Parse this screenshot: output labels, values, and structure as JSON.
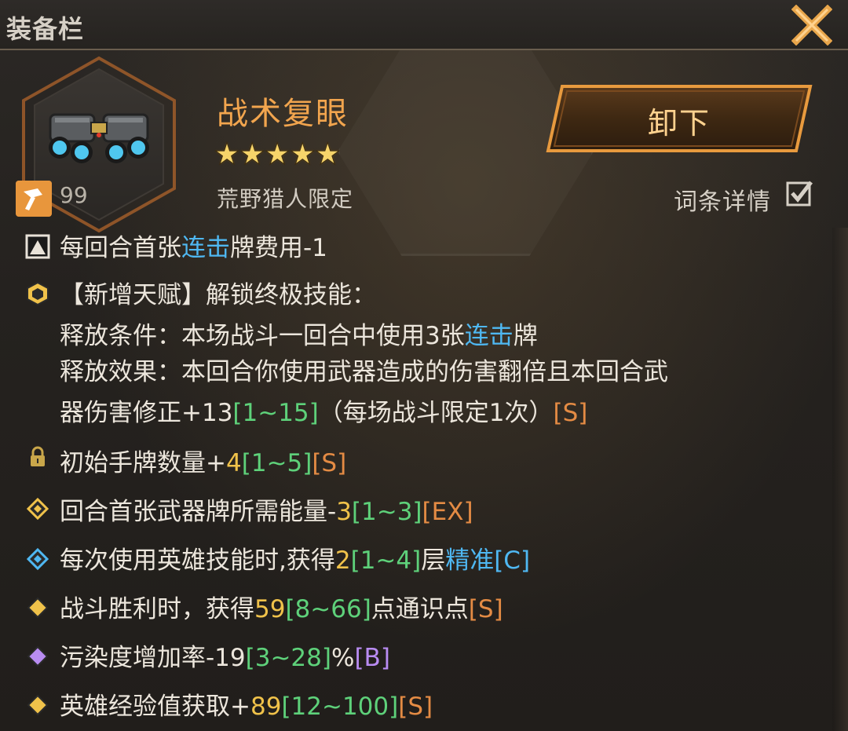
{
  "header": {
    "title": "装备栏",
    "close_icon": "close-x-icon"
  },
  "item": {
    "name": "战术复眼",
    "stars": "★★★★★",
    "star_count": 5,
    "source": "荒野猎人限定",
    "level": "99",
    "image_icon": "tactical-goggles-icon"
  },
  "actions": {
    "unequip_label": "卸下",
    "detail_label": "词条详情",
    "detail_checked": true
  },
  "colors": {
    "accent_orange": "#f2a54e",
    "keyword_blue": "#4fb8f2",
    "value_yellow": "#f0c24a",
    "range_green": "#5ed17a",
    "tier_s": "#e48b44",
    "tier_b": "#b98cf2"
  },
  "attributes": [
    {
      "text_a": "每回合首张",
      "kw": "连击",
      "text_b": "牌费用-1"
    },
    {
      "line1": "【新增天赋】解锁终极技能：",
      "line2_a": "释放条件：本场战斗一回合中使用3张",
      "line2_kw": "连击",
      "line2_b": "牌",
      "line3": "释放效果：本回合你使用武器造成的伤害翻倍且本回合武",
      "line4_a": "器伤害修正+13",
      "line4_range": "[1~15]",
      "line4_b": "（每场战斗限定1次）",
      "line4_tier": "[S]"
    },
    {
      "label": "初始手牌数量+",
      "value": "4",
      "range": "[1~5]",
      "tier": "[S]"
    },
    {
      "label": "回合首张武器牌所需能量-",
      "value": "3",
      "range": "[1~3]",
      "tier": "[EX]"
    },
    {
      "label": "每次使用英雄技能时,获得",
      "value": "2",
      "range": "[1~4]",
      "mid": "层",
      "kw": "精准",
      "tier": "[C]"
    },
    {
      "label": "战斗胜利时，获得",
      "value": "59",
      "range": "[8~66]",
      "mid": "点通识点",
      "tier": "[S]"
    },
    {
      "label": "污染度增加率-",
      "value": "19",
      "range": "[3~28]",
      "mid": "%",
      "tier": "[B]"
    },
    {
      "label": "英雄经验值获取+",
      "value": "89",
      "range": "[12~100]",
      "tier": "[S]"
    }
  ]
}
